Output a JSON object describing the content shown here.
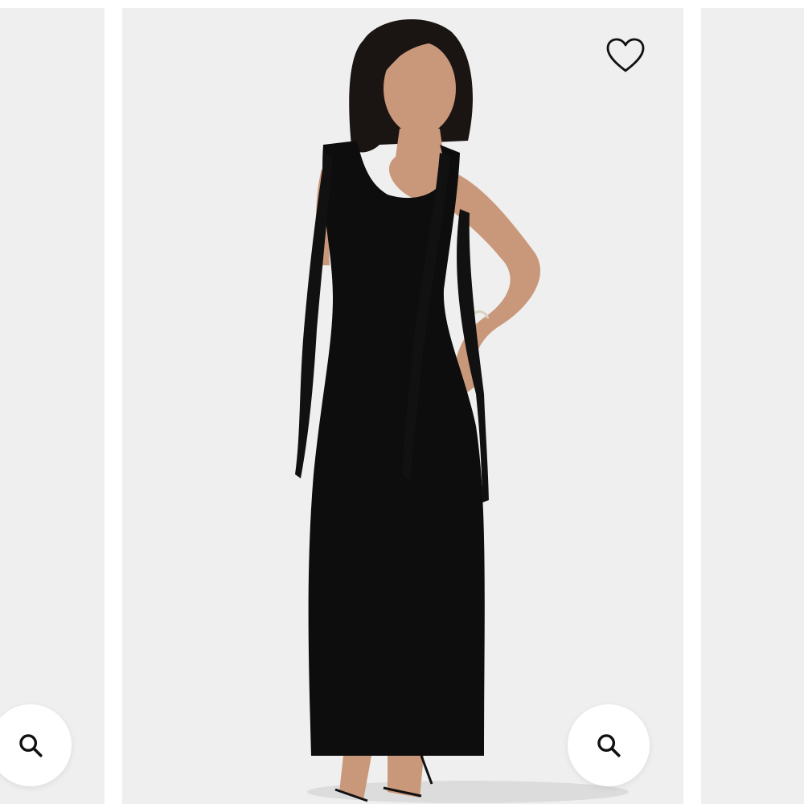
{
  "carousel": {
    "slides": [
      {
        "position": "previous",
        "image_icon": "product-photo-partial"
      },
      {
        "position": "current",
        "image_icon": "product-photo-black-maxi-dress"
      },
      {
        "position": "next",
        "image_icon": "product-photo-partial"
      }
    ],
    "wishlist": {
      "icon": "heart-outline-icon"
    },
    "zoom": {
      "icon": "magnifier-icon"
    }
  },
  "colors": {
    "page_background": "#ffffff",
    "slide_background": "#efefef",
    "dress": "#0d0d0d",
    "skin": "#c9987a",
    "hair": "#1a1412",
    "icon_stroke": "#111111"
  }
}
